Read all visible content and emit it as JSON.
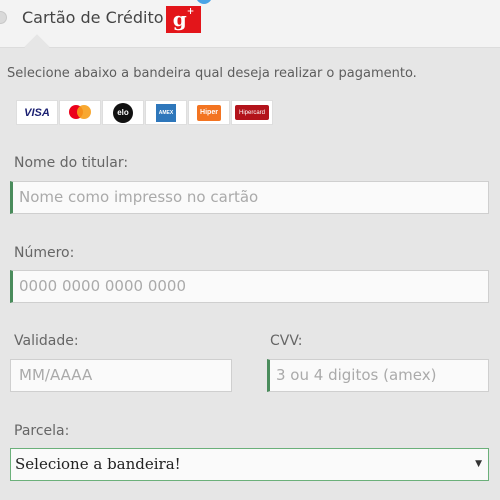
{
  "header": {
    "title": "Cartão de Crédito",
    "logo_letter": "g",
    "logo_superscript": "+"
  },
  "instruction": "Selecione abaixo a bandeira qual deseja realizar o pagamento.",
  "brands": [
    {
      "name": "visa",
      "label": "VISA"
    },
    {
      "name": "mastercard",
      "label": ""
    },
    {
      "name": "elo",
      "label": "elo"
    },
    {
      "name": "amex",
      "label": "AMEX"
    },
    {
      "name": "hiper",
      "label": "Hiper"
    },
    {
      "name": "hipercard",
      "label": "Hipercard"
    }
  ],
  "form": {
    "holder": {
      "label": "Nome do titular:",
      "placeholder": "Nome como impresso no cartão"
    },
    "number": {
      "label": "Número:",
      "placeholder": "0000 0000 0000 0000"
    },
    "expiry": {
      "label": "Validade:",
      "placeholder": "MM/AAAA"
    },
    "cvv": {
      "label": "CVV:",
      "placeholder": "3 ou 4 digitos (amex)"
    },
    "installments": {
      "label": "Parcela:",
      "selected": "Selecione a bandeira!"
    }
  },
  "colors": {
    "accent_border": "#4a8c5c",
    "select_border": "#6bb07a",
    "brand_red": "#e3151a"
  }
}
